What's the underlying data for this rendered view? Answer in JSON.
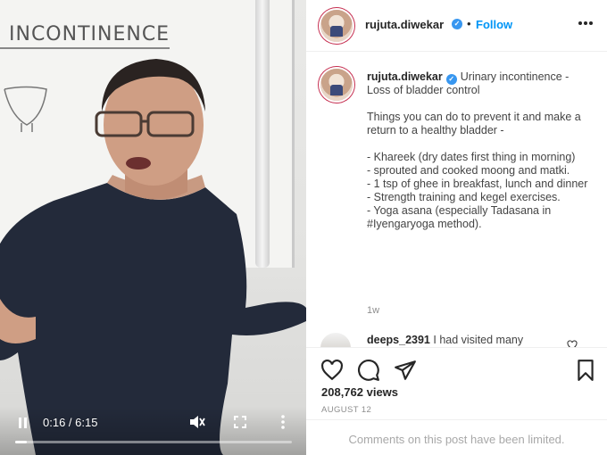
{
  "video": {
    "board_text": "INCONTINENCE",
    "current_time": "0:16",
    "duration": "6:15",
    "time_display": "0:16 / 6:15",
    "progress_fraction": 0.043
  },
  "post": {
    "username": "rujuta.diwekar",
    "follow_label": "Follow",
    "caption_username": "rujuta.diwekar",
    "caption_text": "Urinary incontinence - Loss of bladder control\n\nThings you can do to prevent it and make a return to a healthy bladder -\n\n- Khareek (dry dates first thing in morning)\n- sprouted and cooked moong and matki.\n- 1 tsp of ghee in breakfast, lunch and dinner\n- Strength training and kegel exercises.\n- Yoga asana (especially Tadasana in #Iyengaryoga method).",
    "caption_age": "1w",
    "comment_username": "deeps_2391",
    "comment_text": "I had visited many",
    "views": "208,762 views",
    "date": "AUGUST 12",
    "comments_limited": "Comments on this post have been limited."
  },
  "icons": [
    "pause-icon",
    "mute-icon",
    "fullscreen-icon",
    "more-options-icon",
    "verified-icon",
    "heart-icon",
    "comment-icon",
    "share-icon",
    "bookmark-icon"
  ],
  "colors": {
    "accent": "#0095f6",
    "verified": "#3897f0",
    "muted": "#8e8e8e"
  }
}
